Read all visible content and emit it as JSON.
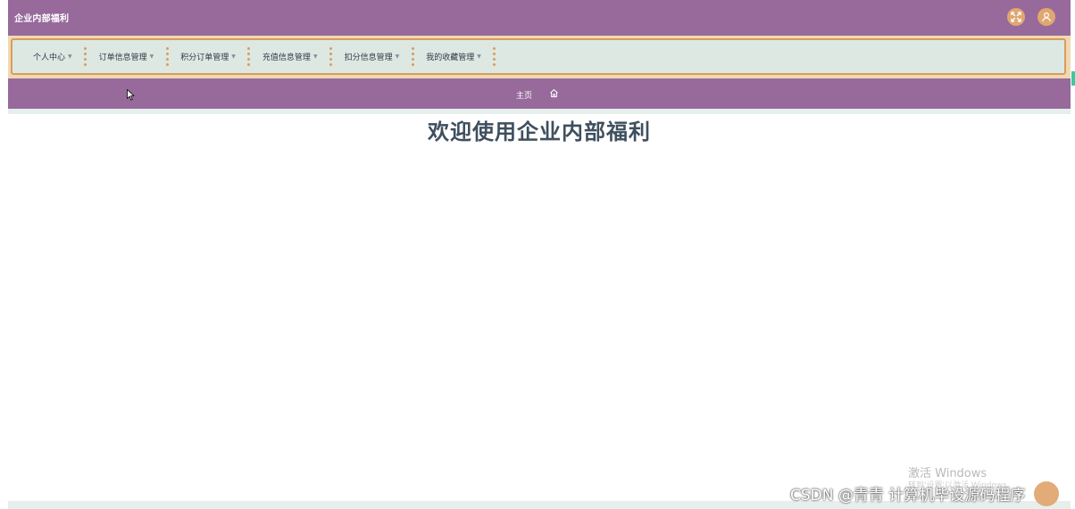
{
  "header": {
    "app_title": "企业内部福利",
    "fullscreen_icon": "fullscreen-toggle-icon",
    "user_icon": "user-icon"
  },
  "menu": {
    "items": [
      {
        "label": "个人中心"
      },
      {
        "label": "订单信息管理"
      },
      {
        "label": "积分订单管理"
      },
      {
        "label": "充值信息管理"
      },
      {
        "label": "扣分信息管理"
      },
      {
        "label": "我的收藏管理"
      }
    ],
    "caret": "▼"
  },
  "breadcrumb": {
    "label": "主页",
    "home_icon": "home-icon"
  },
  "main": {
    "welcome_text": "欢迎使用企业内部福利"
  },
  "overlay": {
    "windows_activate": "激活 Windows",
    "windows_activate_sub": "转到'设置'以激活 Windows。",
    "csdn_watermark": "CSDN @青青  计算机毕设源码程序"
  },
  "colors": {
    "primary_purple": "#976a9b",
    "accent_orange": "#e0a770",
    "menu_bg": "#dde8e3",
    "title_text": "#3f4f5e"
  }
}
